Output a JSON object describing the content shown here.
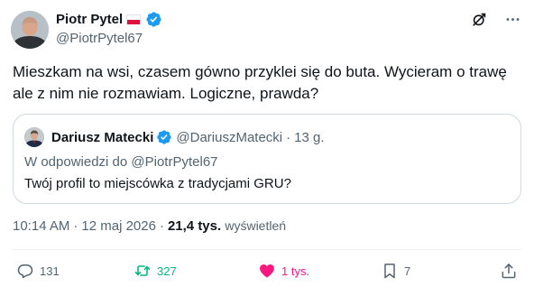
{
  "author": {
    "display_name": "Piotr Pytel",
    "handle": "@PiotrPytel67"
  },
  "header_icons": [
    "grok-icon",
    "more-icon"
  ],
  "tweet": {
    "text": "Mieszkam na wsi, czasem gówno przyklei się do buta. Wycieram o trawę ale z nim nie rozmawiam. Logiczne, prawda?"
  },
  "quote": {
    "display_name": "Dariusz Matecki",
    "handle": "@DariuszMatecki",
    "separator": "·",
    "time": "13 g.",
    "reply_context": "W odpowiedzi do @PiotrPytel67",
    "text": "Twój profil to miejscówka z tradycjami GRU?"
  },
  "meta": {
    "time": "10:14 AM",
    "separator": "·",
    "date": "12 maj 2026",
    "views_count": "21,4 tys.",
    "views_label": "wyświetleń"
  },
  "actions": {
    "replies": "131",
    "reposts": "327",
    "likes": "1 tys.",
    "bookmarks": "7"
  },
  "colors": {
    "text": "#0f1419",
    "secondary": "#536471",
    "verified": "#1d9bf0",
    "repost": "#00ba7c",
    "like": "#f91880",
    "border": "#cfd9de"
  }
}
